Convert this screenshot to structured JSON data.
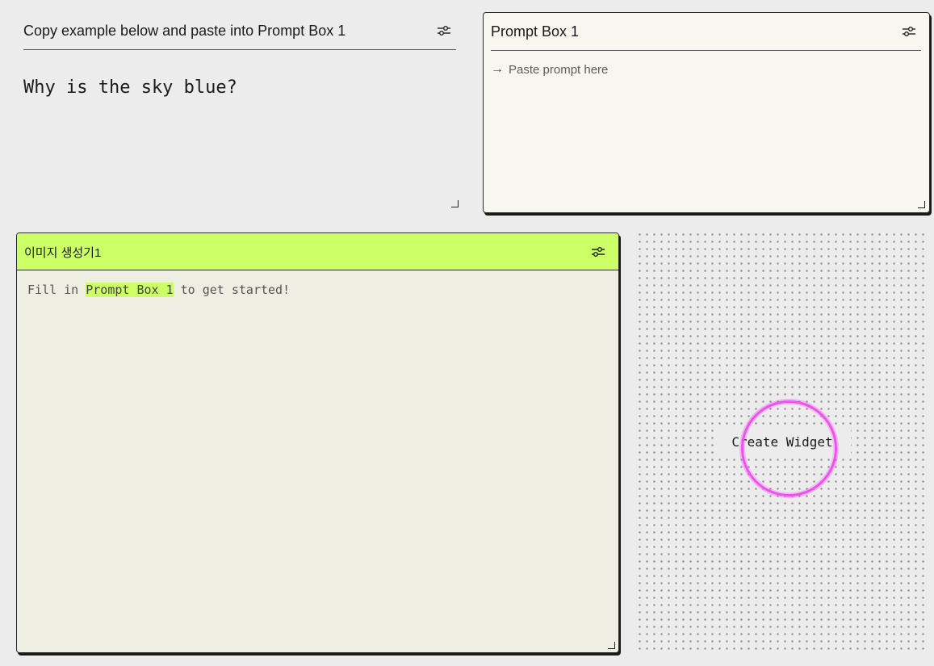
{
  "example_panel": {
    "title": "Copy example below and paste into Prompt Box 1",
    "example_text": "Why is the sky blue?"
  },
  "prompt_box": {
    "title": "Prompt Box 1",
    "input_placeholder": "Paste prompt here",
    "input_value": ""
  },
  "image_generator": {
    "title": "이미지 생성기1",
    "message_before": "Fill in ",
    "message_highlight": "Prompt Box 1",
    "message_after": " to get started!"
  },
  "canvas": {
    "create_widget_label": "Create Widget"
  },
  "icons": {
    "settings": "settings-sliders-icon",
    "arrow": "arrow-right-icon",
    "resize": "resize-handle-icon"
  },
  "colors": {
    "accent_green": "#ccff66",
    "highlight_magenta": "#f050f0"
  }
}
